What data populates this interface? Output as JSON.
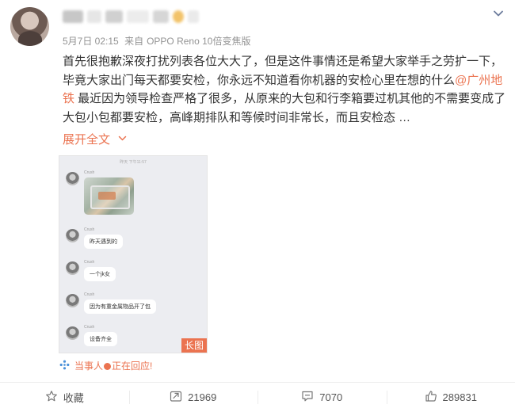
{
  "author": {
    "name_obscured": true
  },
  "meta": {
    "date": "5月7日 02:15",
    "source_prefix": "来自",
    "device": "OPPO Reno 10倍变焦版"
  },
  "content": {
    "part1": "首先很抱歉深夜打扰列表各位大大了，但是这件事情还是希望大家举手之劳扩一下，毕竟大家出门每天都要安检，你永远不知道看你机器的安检心里在想的什么",
    "mention": "@广州地铁",
    "part2": " 最近因为领导检查严格了很多，从原来的大包和行李箱要过机其他的不需要变成了大包小包都要安检，高峰期排队和等候时间非常长，而且安检态 …"
  },
  "expand_label": "展开全文",
  "attachment": {
    "timestamp": "昨天 下午11:57",
    "sender": "Crush",
    "messages": [
      "昨天遇到的",
      "一个jk女",
      "因为有重金属物品开了包",
      "设备齐全"
    ],
    "long_tag": "长图"
  },
  "participant": {
    "prefix": "当事人",
    "suffix": "正在回应!"
  },
  "actions": {
    "favorite": "收藏",
    "repost": "21969",
    "comment": "7070",
    "like": "289831"
  },
  "colors": {
    "accent": "#eb7350",
    "meta": "#939393",
    "text": "#333333"
  },
  "icons": [
    "chevron-down-icon",
    "participant-icon",
    "star-icon",
    "repost-icon",
    "comment-icon",
    "like-icon"
  ]
}
